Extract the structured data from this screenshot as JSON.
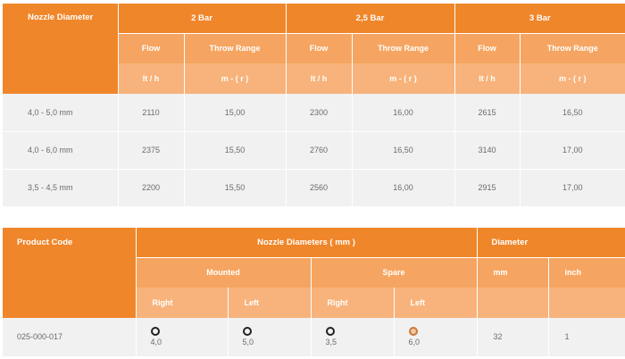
{
  "table1": {
    "header": {
      "nozzle_diameter": "Nozzle Diameter",
      "pressures": [
        "2 Bar",
        "2,5 Bar",
        "3 Bar"
      ],
      "flow": "Flow",
      "throw_range": "Throw Range",
      "flow_unit": "lt / h",
      "range_unit": "m - ( r )"
    },
    "rows": [
      {
        "diameter": "4,0 - 5,0 mm",
        "values": [
          "2110",
          "15,00",
          "2300",
          "16,00",
          "2615",
          "16,50"
        ]
      },
      {
        "diameter": "4,0 - 6,0 mm",
        "values": [
          "2375",
          "15,50",
          "2760",
          "16,50",
          "3140",
          "17,00"
        ]
      },
      {
        "diameter": "3,5 - 4,5 mm",
        "values": [
          "2200",
          "15,50",
          "2560",
          "16,00",
          "2915",
          "17,00"
        ]
      }
    ]
  },
  "table2": {
    "header": {
      "product_code": "Product Code",
      "nozzle_diameters": "Nozzle Diameters ( mm )",
      "diameter": "Diameter",
      "mounted": "Mounted",
      "spare": "Spare",
      "mm": "mm",
      "inch": "inch",
      "right": "Right",
      "left": "Left"
    },
    "row": {
      "code": "025-000-017",
      "mounted_right": "4,0",
      "mounted_left": "5,0",
      "spare_right": "3,5",
      "spare_left": "6,0",
      "mm": "32",
      "inch": "1"
    },
    "icons": [
      "ring-black-icon",
      "ring-black-icon",
      "ring-black-icon",
      "ring-orange-icon"
    ]
  }
}
